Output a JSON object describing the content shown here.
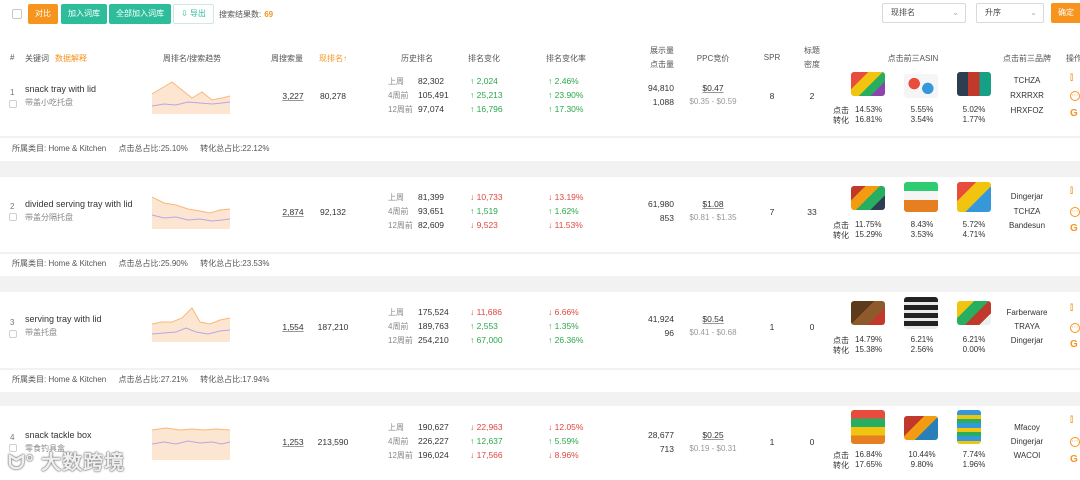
{
  "toolbar": {
    "compare_label": "对比",
    "add_label": "加入词库",
    "add_all_label": "全部加入词库",
    "export_label": "导出",
    "result_label": "搜索结果数:",
    "result_count": "69",
    "sort_field": "现排名",
    "sort_order": "升序",
    "confirm_label": "确定"
  },
  "headers": {
    "idx": "#",
    "keyword": "关键词",
    "keyword_sub": "数据解释",
    "trend": "周排名/搜索趋势",
    "weekly_search": "周搜索量",
    "rank": "现排名↑",
    "hist_rank": "历史排名",
    "rank_change": "排名变化",
    "rank_change_rate": "排名变化率",
    "impr_line1": "展示量",
    "impr_line2": "点击量",
    "ppc": "PPC竞价",
    "spr": "SPR",
    "title_line1": "标题",
    "title_line2": "密度",
    "top3_asin": "点击前三ASIN",
    "top3_brand": "点击前三品牌",
    "ops": "操作"
  },
  "labels": {
    "hist_periods": [
      "上周",
      "4周前",
      "12周前"
    ],
    "click": "点击",
    "conv": "转化"
  },
  "rows": [
    {
      "idx": "1",
      "keyword": "snack tray with lid",
      "keyword_cn": "带盖小吃托盘",
      "weekly_search": "3,227",
      "rank": "80,278",
      "hist": [
        "82,302",
        "105,491",
        "97,074"
      ],
      "changes": [
        {
          "dir": "up",
          "v": "2,024"
        },
        {
          "dir": "up",
          "v": "25,213"
        },
        {
          "dir": "up",
          "v": "16,796"
        }
      ],
      "rates": [
        {
          "dir": "up",
          "v": "2.46%"
        },
        {
          "dir": "up",
          "v": "23.90%"
        },
        {
          "dir": "up",
          "v": "17.30%"
        }
      ],
      "impressions": "94,810",
      "clicks": "1,088",
      "ppc": "$0.47",
      "ppc_range": "$0.35 - $0.59",
      "spr": "8",
      "title_density": "2",
      "asin_stats": [
        {
          "click": "14.53%",
          "conv": "16.81%"
        },
        {
          "click": "5.55%",
          "conv": "3.54%"
        },
        {
          "click": "5.02%",
          "conv": "1.77%"
        }
      ],
      "brands": [
        "TCHZA",
        "RXRRXR",
        "HRXFOZ"
      ],
      "category": "所属类目: Home & Kitchen",
      "click_share": "点击总占比:25.10%",
      "conv_share": "转化总占比:22.12%"
    },
    {
      "idx": "2",
      "keyword": "divided serving tray with lid",
      "keyword_cn": "带盖分隔托盘",
      "weekly_search": "2,874",
      "rank": "92,132",
      "hist": [
        "81,399",
        "93,651",
        "82,609"
      ],
      "changes": [
        {
          "dir": "down",
          "v": "10,733"
        },
        {
          "dir": "up",
          "v": "1,519"
        },
        {
          "dir": "down",
          "v": "9,523"
        }
      ],
      "rates": [
        {
          "dir": "down",
          "v": "13.19%"
        },
        {
          "dir": "up",
          "v": "1.62%"
        },
        {
          "dir": "down",
          "v": "11.53%"
        }
      ],
      "impressions": "61,980",
      "clicks": "853",
      "ppc": "$1.08",
      "ppc_range": "$0.81 - $1.35",
      "spr": "7",
      "title_density": "33",
      "asin_stats": [
        {
          "click": "11.75%",
          "conv": "15.29%"
        },
        {
          "click": "8.43%",
          "conv": "3.53%"
        },
        {
          "click": "5.72%",
          "conv": "4.71%"
        }
      ],
      "brands": [
        "Dingerjar",
        "TCHZA",
        "Bandesun"
      ],
      "category": "所属类目: Home & Kitchen",
      "click_share": "点击总占比:25.90%",
      "conv_share": "转化总占比:23.53%"
    },
    {
      "idx": "3",
      "keyword": "serving tray with lid",
      "keyword_cn": "带盖托盘",
      "weekly_search": "1,554",
      "rank": "187,210",
      "hist": [
        "175,524",
        "189,763",
        "254,210"
      ],
      "changes": [
        {
          "dir": "down",
          "v": "11,686"
        },
        {
          "dir": "up",
          "v": "2,553"
        },
        {
          "dir": "up",
          "v": "67,000"
        }
      ],
      "rates": [
        {
          "dir": "down",
          "v": "6.66%"
        },
        {
          "dir": "up",
          "v": "1.35%"
        },
        {
          "dir": "up",
          "v": "26.36%"
        }
      ],
      "impressions": "41,924",
      "clicks": "96",
      "ppc": "$0.54",
      "ppc_range": "$0.41 - $0.68",
      "spr": "1",
      "title_density": "0",
      "asin_stats": [
        {
          "click": "14.79%",
          "conv": "15.38%"
        },
        {
          "click": "6.21%",
          "conv": "2.56%"
        },
        {
          "click": "6.21%",
          "conv": "0.00%"
        }
      ],
      "brands": [
        "Farberware",
        "TRAYA",
        "Dingerjar"
      ],
      "category": "所属类目: Home & Kitchen",
      "click_share": "点击总占比:27.21%",
      "conv_share": "转化总占比:17.94%"
    },
    {
      "idx": "4",
      "keyword": "snack tackle box",
      "keyword_cn": "零食钓具盒",
      "weekly_search": "1,253",
      "rank": "213,590",
      "hist": [
        "190,627",
        "226,227",
        "196,024"
      ],
      "changes": [
        {
          "dir": "down",
          "v": "22,963"
        },
        {
          "dir": "up",
          "v": "12,637"
        },
        {
          "dir": "down",
          "v": "17,566"
        }
      ],
      "rates": [
        {
          "dir": "down",
          "v": "12.05%"
        },
        {
          "dir": "up",
          "v": "5.59%"
        },
        {
          "dir": "down",
          "v": "8.96%"
        }
      ],
      "impressions": "28,677",
      "clicks": "713",
      "ppc": "$0.25",
      "ppc_range": "$0.19 - $0.31",
      "spr": "1",
      "title_density": "0",
      "asin_stats": [
        {
          "click": "16.84%",
          "conv": "17.65%"
        },
        {
          "click": "10.44%",
          "conv": "9.80%"
        },
        {
          "click": "7.74%",
          "conv": "1.96%"
        }
      ],
      "brands": [
        "Mfacoy",
        "Dingerjar",
        "WACOI"
      ],
      "category": "",
      "click_share": "",
      "conv_share": ""
    }
  ],
  "watermark": "大数跨境",
  "colors": {
    "accent": "#f7941d",
    "green": "#2ebd9b",
    "up": "#2aa84a",
    "down": "#e0473f"
  }
}
